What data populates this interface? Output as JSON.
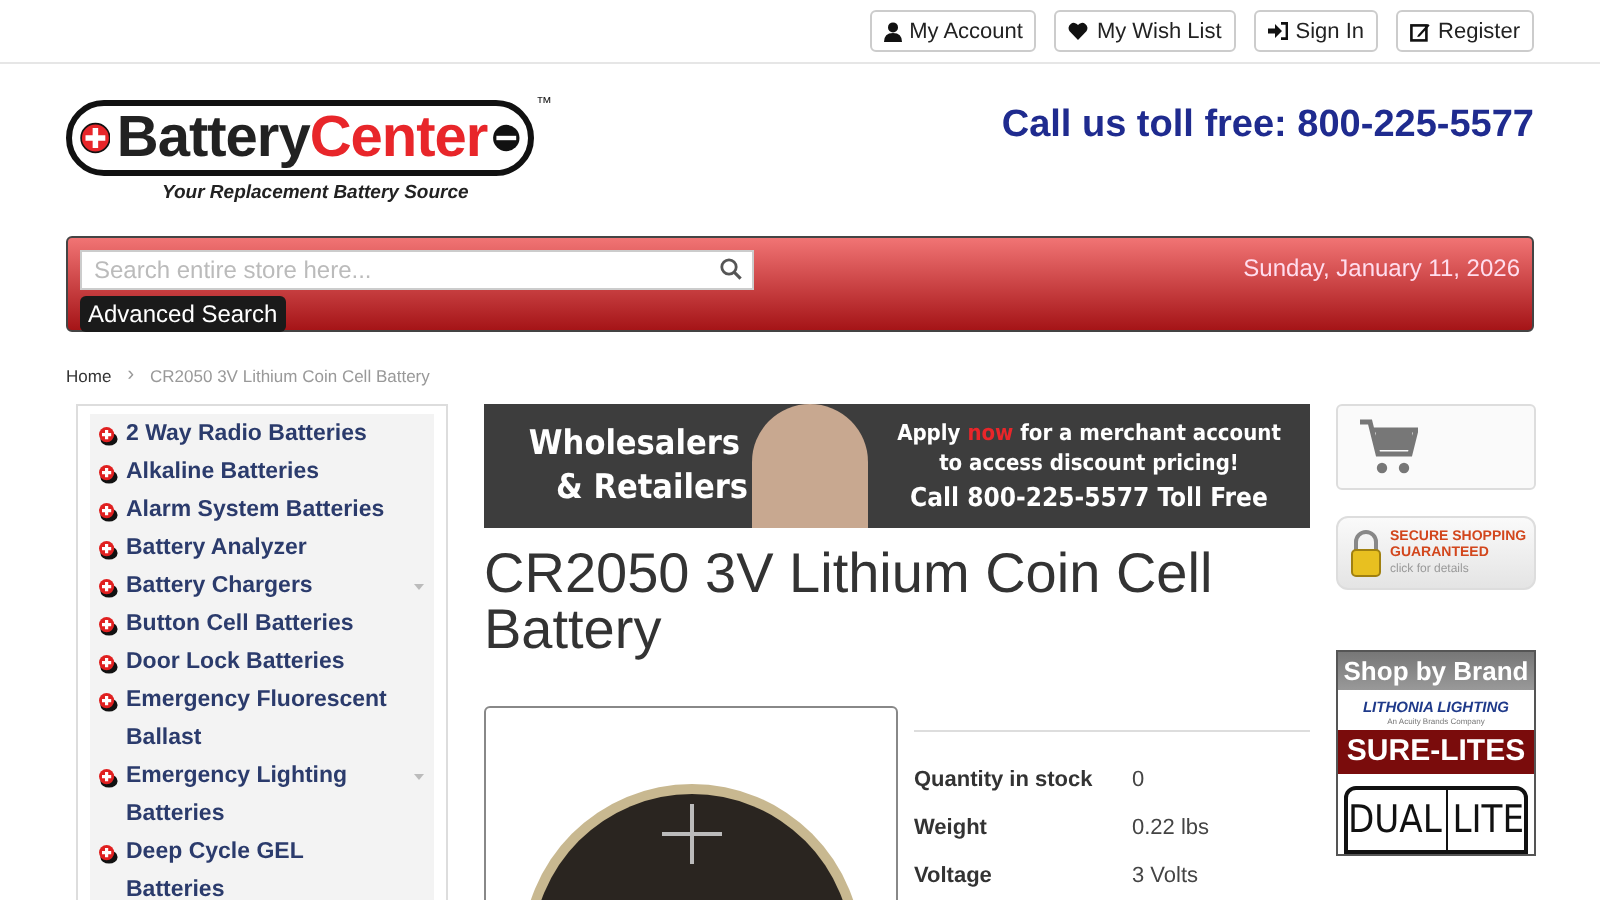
{
  "top_links": [
    {
      "label": "My Account"
    },
    {
      "label": "My Wish List"
    },
    {
      "label": "Sign In"
    },
    {
      "label": "Register"
    }
  ],
  "logo": {
    "name_first": "Battery",
    "name_second": "Center",
    "trademark": "™",
    "tagline": "Your Replacement Battery Source"
  },
  "phone": "Call us toll free: 800-225-5577",
  "search": {
    "placeholder": "Search entire store here...",
    "advanced": "Advanced Search",
    "date": "Sunday, January 11, 2026"
  },
  "breadcrumbs": [
    {
      "label": "Home",
      "current": false
    },
    {
      "label": "CR2050 3V Lithium Coin Cell Battery",
      "current": true
    }
  ],
  "breadcrumb_separator": "›",
  "sidebar": {
    "items": [
      {
        "label": "2 Way Radio Batteries",
        "expandable": false
      },
      {
        "label": "Alkaline Batteries",
        "expandable": false
      },
      {
        "label": "Alarm System Batteries",
        "expandable": false
      },
      {
        "label": "Battery Analyzer",
        "expandable": false
      },
      {
        "label": "Battery Chargers",
        "expandable": true
      },
      {
        "label": "Button Cell Batteries",
        "expandable": false
      },
      {
        "label": "Door Lock Batteries",
        "expandable": false
      },
      {
        "label": "Emergency Fluorescent Ballast",
        "expandable": false
      },
      {
        "label": "Emergency Lighting Batteries",
        "expandable": true
      },
      {
        "label": "Deep Cycle GEL Batteries",
        "expandable": false
      }
    ]
  },
  "promo": {
    "line_1": "Wholesalers",
    "line_2": "& Retailers",
    "apply_before": "Apply ",
    "apply_now": "now",
    "apply_after": " for a merchant account",
    "access": "to access discount pricing!",
    "call": "Call 800-225-5577 Toll Free"
  },
  "product": {
    "title": "CR2050 3V Lithium Coin Cell Battery",
    "specs": [
      {
        "label": "Quantity in stock",
        "value": "0"
      },
      {
        "label": "Weight",
        "value": "0.22 lbs"
      },
      {
        "label": "Voltage",
        "value": "3 Volts"
      }
    ]
  },
  "secure": {
    "line_1": "SECURE SHOPPING",
    "line_2": "GUARANTEED",
    "line_3": "click for details"
  },
  "brands": {
    "title": "Shop by Brand",
    "items": [
      {
        "label": "LITHONIA LIGHTING",
        "kind": "lithonia",
        "subtitle": "An Acuity Brands Company"
      },
      {
        "label": "SURE-LITES",
        "kind": "surelites"
      },
      {
        "label": "DUAL",
        "label_2": "LITE",
        "kind": "duallite"
      }
    ]
  }
}
